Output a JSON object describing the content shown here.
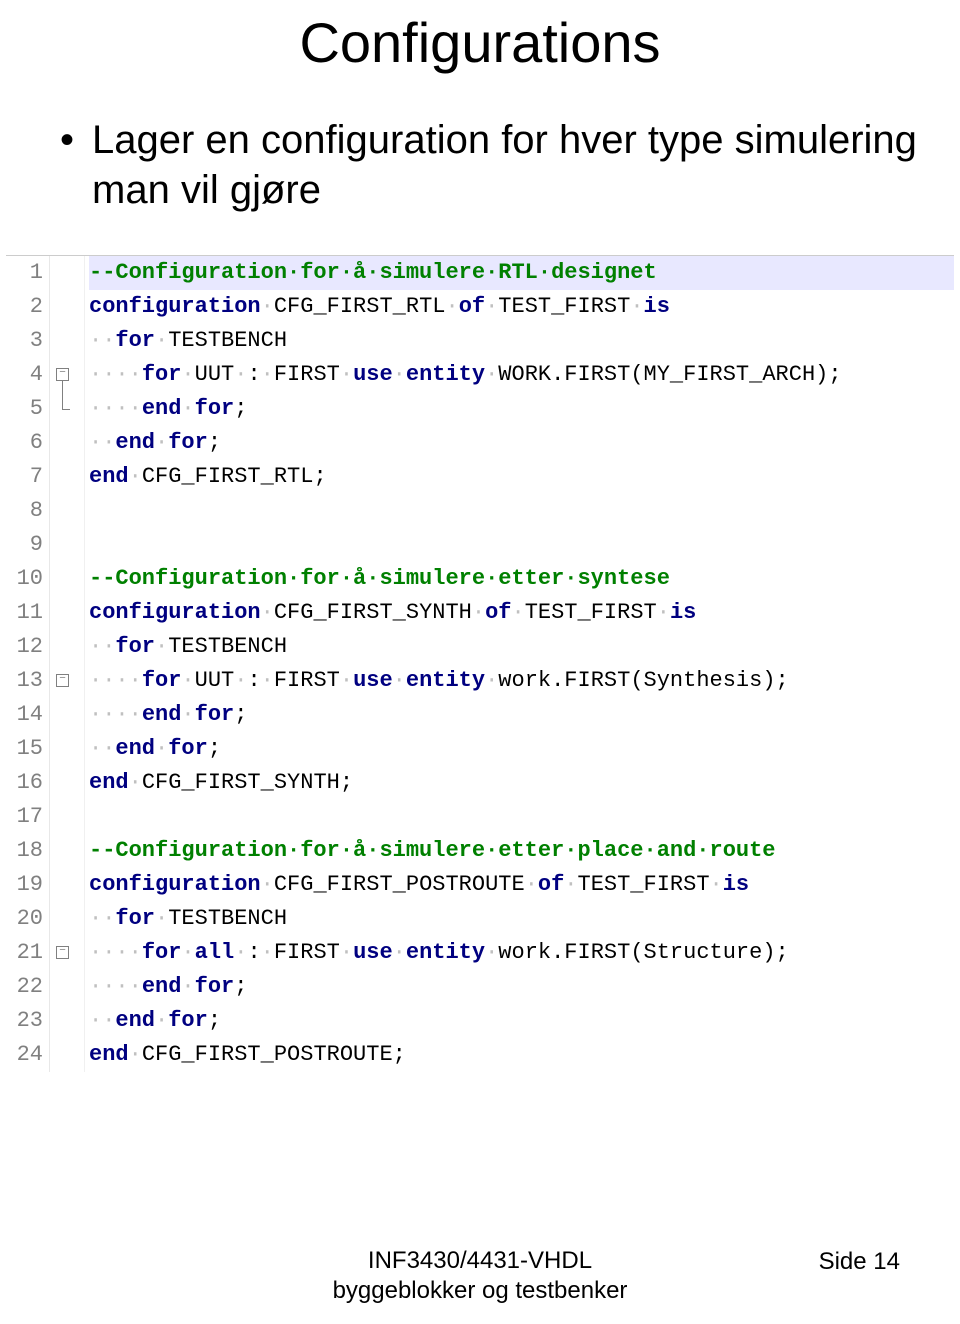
{
  "title": "Configurations",
  "bullet": "Lager en configuration for hver type simulering man vil gjøre",
  "footer_center_line1": "INF3430/4431-VHDL",
  "footer_center_line2": "byggeblokker og testbenker",
  "footer_right": "Side 14",
  "code": {
    "lines": [
      {
        "n": 1,
        "hl": true,
        "tokens": [
          {
            "c": "cm",
            "t": "--Configuration·for·å·simulere·RTL·designet"
          }
        ]
      },
      {
        "n": 2,
        "tokens": [
          {
            "c": "kw",
            "t": "configuration"
          },
          {
            "c": "ws",
            "t": "·"
          },
          {
            "c": "pl",
            "t": "CFG_FIRST_RTL"
          },
          {
            "c": "ws",
            "t": "·"
          },
          {
            "c": "kw",
            "t": "of"
          },
          {
            "c": "ws",
            "t": "·"
          },
          {
            "c": "pl",
            "t": "TEST_FIRST"
          },
          {
            "c": "ws",
            "t": "·"
          },
          {
            "c": "kw",
            "t": "is"
          }
        ]
      },
      {
        "n": 3,
        "tokens": [
          {
            "c": "ws",
            "t": "··"
          },
          {
            "c": "kw",
            "t": "for"
          },
          {
            "c": "ws",
            "t": "·"
          },
          {
            "c": "pl",
            "t": "TESTBENCH"
          }
        ]
      },
      {
        "n": 4,
        "fold": "minus",
        "tokens": [
          {
            "c": "ws",
            "t": "····"
          },
          {
            "c": "kw",
            "t": "for"
          },
          {
            "c": "ws",
            "t": "·"
          },
          {
            "c": "pl",
            "t": "UUT"
          },
          {
            "c": "ws",
            "t": "·"
          },
          {
            "c": "pl",
            "t": ":"
          },
          {
            "c": "ws",
            "t": "·"
          },
          {
            "c": "pl",
            "t": "FIRST"
          },
          {
            "c": "ws",
            "t": "·"
          },
          {
            "c": "kw",
            "t": "use"
          },
          {
            "c": "ws",
            "t": "·"
          },
          {
            "c": "kw",
            "t": "entity"
          },
          {
            "c": "ws",
            "t": "·"
          },
          {
            "c": "pl",
            "t": "WORK.FIRST(MY_FIRST_ARCH);"
          }
        ]
      },
      {
        "n": 5,
        "fold": "end",
        "tokens": [
          {
            "c": "ws",
            "t": "····"
          },
          {
            "c": "kw",
            "t": "end"
          },
          {
            "c": "ws",
            "t": "·"
          },
          {
            "c": "kw",
            "t": "for"
          },
          {
            "c": "pl",
            "t": ";"
          }
        ]
      },
      {
        "n": 6,
        "tokens": [
          {
            "c": "ws",
            "t": "··"
          },
          {
            "c": "kw",
            "t": "end"
          },
          {
            "c": "ws",
            "t": "·"
          },
          {
            "c": "kw",
            "t": "for"
          },
          {
            "c": "pl",
            "t": ";"
          }
        ]
      },
      {
        "n": 7,
        "tokens": [
          {
            "c": "kw",
            "t": "end"
          },
          {
            "c": "ws",
            "t": "·"
          },
          {
            "c": "pl",
            "t": "CFG_FIRST_RTL;"
          }
        ]
      },
      {
        "n": 8,
        "tokens": []
      },
      {
        "n": 9,
        "tokens": []
      },
      {
        "n": 10,
        "tokens": [
          {
            "c": "cm",
            "t": "--Configuration·for·å·simulere·etter·syntese"
          }
        ]
      },
      {
        "n": 11,
        "tokens": [
          {
            "c": "kw",
            "t": "configuration"
          },
          {
            "c": "ws",
            "t": "·"
          },
          {
            "c": "pl",
            "t": "CFG_FIRST_SYNTH"
          },
          {
            "c": "ws",
            "t": "·"
          },
          {
            "c": "kw",
            "t": "of"
          },
          {
            "c": "ws",
            "t": "·"
          },
          {
            "c": "pl",
            "t": "TEST_FIRST"
          },
          {
            "c": "ws",
            "t": "·"
          },
          {
            "c": "kw",
            "t": "is"
          }
        ]
      },
      {
        "n": 12,
        "tokens": [
          {
            "c": "ws",
            "t": "··"
          },
          {
            "c": "kw",
            "t": "for"
          },
          {
            "c": "ws",
            "t": "·"
          },
          {
            "c": "pl",
            "t": "TESTBENCH"
          }
        ]
      },
      {
        "n": 13,
        "fold": "minus",
        "tokens": [
          {
            "c": "ws",
            "t": "····"
          },
          {
            "c": "kw",
            "t": "for"
          },
          {
            "c": "ws",
            "t": "·"
          },
          {
            "c": "pl",
            "t": "UUT"
          },
          {
            "c": "ws",
            "t": "·"
          },
          {
            "c": "pl",
            "t": ":"
          },
          {
            "c": "ws",
            "t": "·"
          },
          {
            "c": "pl",
            "t": "FIRST"
          },
          {
            "c": "ws",
            "t": "·"
          },
          {
            "c": "kw",
            "t": "use"
          },
          {
            "c": "ws",
            "t": "·"
          },
          {
            "c": "kw",
            "t": "entity"
          },
          {
            "c": "ws",
            "t": "·"
          },
          {
            "c": "pl",
            "t": "work.FIRST(Synthesis);"
          }
        ]
      },
      {
        "n": 14,
        "tokens": [
          {
            "c": "ws",
            "t": "····"
          },
          {
            "c": "kw",
            "t": "end"
          },
          {
            "c": "ws",
            "t": "·"
          },
          {
            "c": "kw",
            "t": "for"
          },
          {
            "c": "pl",
            "t": ";"
          }
        ]
      },
      {
        "n": 15,
        "tokens": [
          {
            "c": "ws",
            "t": "··"
          },
          {
            "c": "kw",
            "t": "end"
          },
          {
            "c": "ws",
            "t": "·"
          },
          {
            "c": "kw",
            "t": "for"
          },
          {
            "c": "pl",
            "t": ";"
          }
        ]
      },
      {
        "n": 16,
        "tokens": [
          {
            "c": "kw",
            "t": "end"
          },
          {
            "c": "ws",
            "t": "·"
          },
          {
            "c": "pl",
            "t": "CFG_FIRST_SYNTH;"
          }
        ]
      },
      {
        "n": 17,
        "tokens": []
      },
      {
        "n": 18,
        "tokens": [
          {
            "c": "cm",
            "t": "--Configuration·for·å·simulere·etter·place·and·route"
          }
        ]
      },
      {
        "n": 19,
        "tokens": [
          {
            "c": "kw",
            "t": "configuration"
          },
          {
            "c": "ws",
            "t": "·"
          },
          {
            "c": "pl",
            "t": "CFG_FIRST_POSTROUTE"
          },
          {
            "c": "ws",
            "t": "·"
          },
          {
            "c": "kw",
            "t": "of"
          },
          {
            "c": "ws",
            "t": "·"
          },
          {
            "c": "pl",
            "t": "TEST_FIRST"
          },
          {
            "c": "ws",
            "t": "·"
          },
          {
            "c": "kw",
            "t": "is"
          }
        ]
      },
      {
        "n": 20,
        "tokens": [
          {
            "c": "ws",
            "t": "··"
          },
          {
            "c": "kw",
            "t": "for"
          },
          {
            "c": "ws",
            "t": "·"
          },
          {
            "c": "pl",
            "t": "TESTBENCH"
          }
        ]
      },
      {
        "n": 21,
        "fold": "minus",
        "tokens": [
          {
            "c": "ws",
            "t": "····"
          },
          {
            "c": "kw",
            "t": "for"
          },
          {
            "c": "ws",
            "t": "·"
          },
          {
            "c": "kw",
            "t": "all"
          },
          {
            "c": "ws",
            "t": "·"
          },
          {
            "c": "pl",
            "t": ":"
          },
          {
            "c": "ws",
            "t": "·"
          },
          {
            "c": "pl",
            "t": "FIRST"
          },
          {
            "c": "ws",
            "t": "·"
          },
          {
            "c": "kw",
            "t": "use"
          },
          {
            "c": "ws",
            "t": "·"
          },
          {
            "c": "kw",
            "t": "entity"
          },
          {
            "c": "ws",
            "t": "·"
          },
          {
            "c": "pl",
            "t": "work.FIRST(Structure);"
          }
        ]
      },
      {
        "n": 22,
        "tokens": [
          {
            "c": "ws",
            "t": "····"
          },
          {
            "c": "kw",
            "t": "end"
          },
          {
            "c": "ws",
            "t": "·"
          },
          {
            "c": "kw",
            "t": "for"
          },
          {
            "c": "pl",
            "t": ";"
          }
        ]
      },
      {
        "n": 23,
        "tokens": [
          {
            "c": "ws",
            "t": "··"
          },
          {
            "c": "kw",
            "t": "end"
          },
          {
            "c": "ws",
            "t": "·"
          },
          {
            "c": "kw",
            "t": "for"
          },
          {
            "c": "pl",
            "t": ";"
          }
        ]
      },
      {
        "n": 24,
        "tokens": [
          {
            "c": "kw",
            "t": "end"
          },
          {
            "c": "ws",
            "t": "·"
          },
          {
            "c": "pl",
            "t": "CFG_FIRST_POSTROUTE;"
          }
        ]
      }
    ]
  }
}
